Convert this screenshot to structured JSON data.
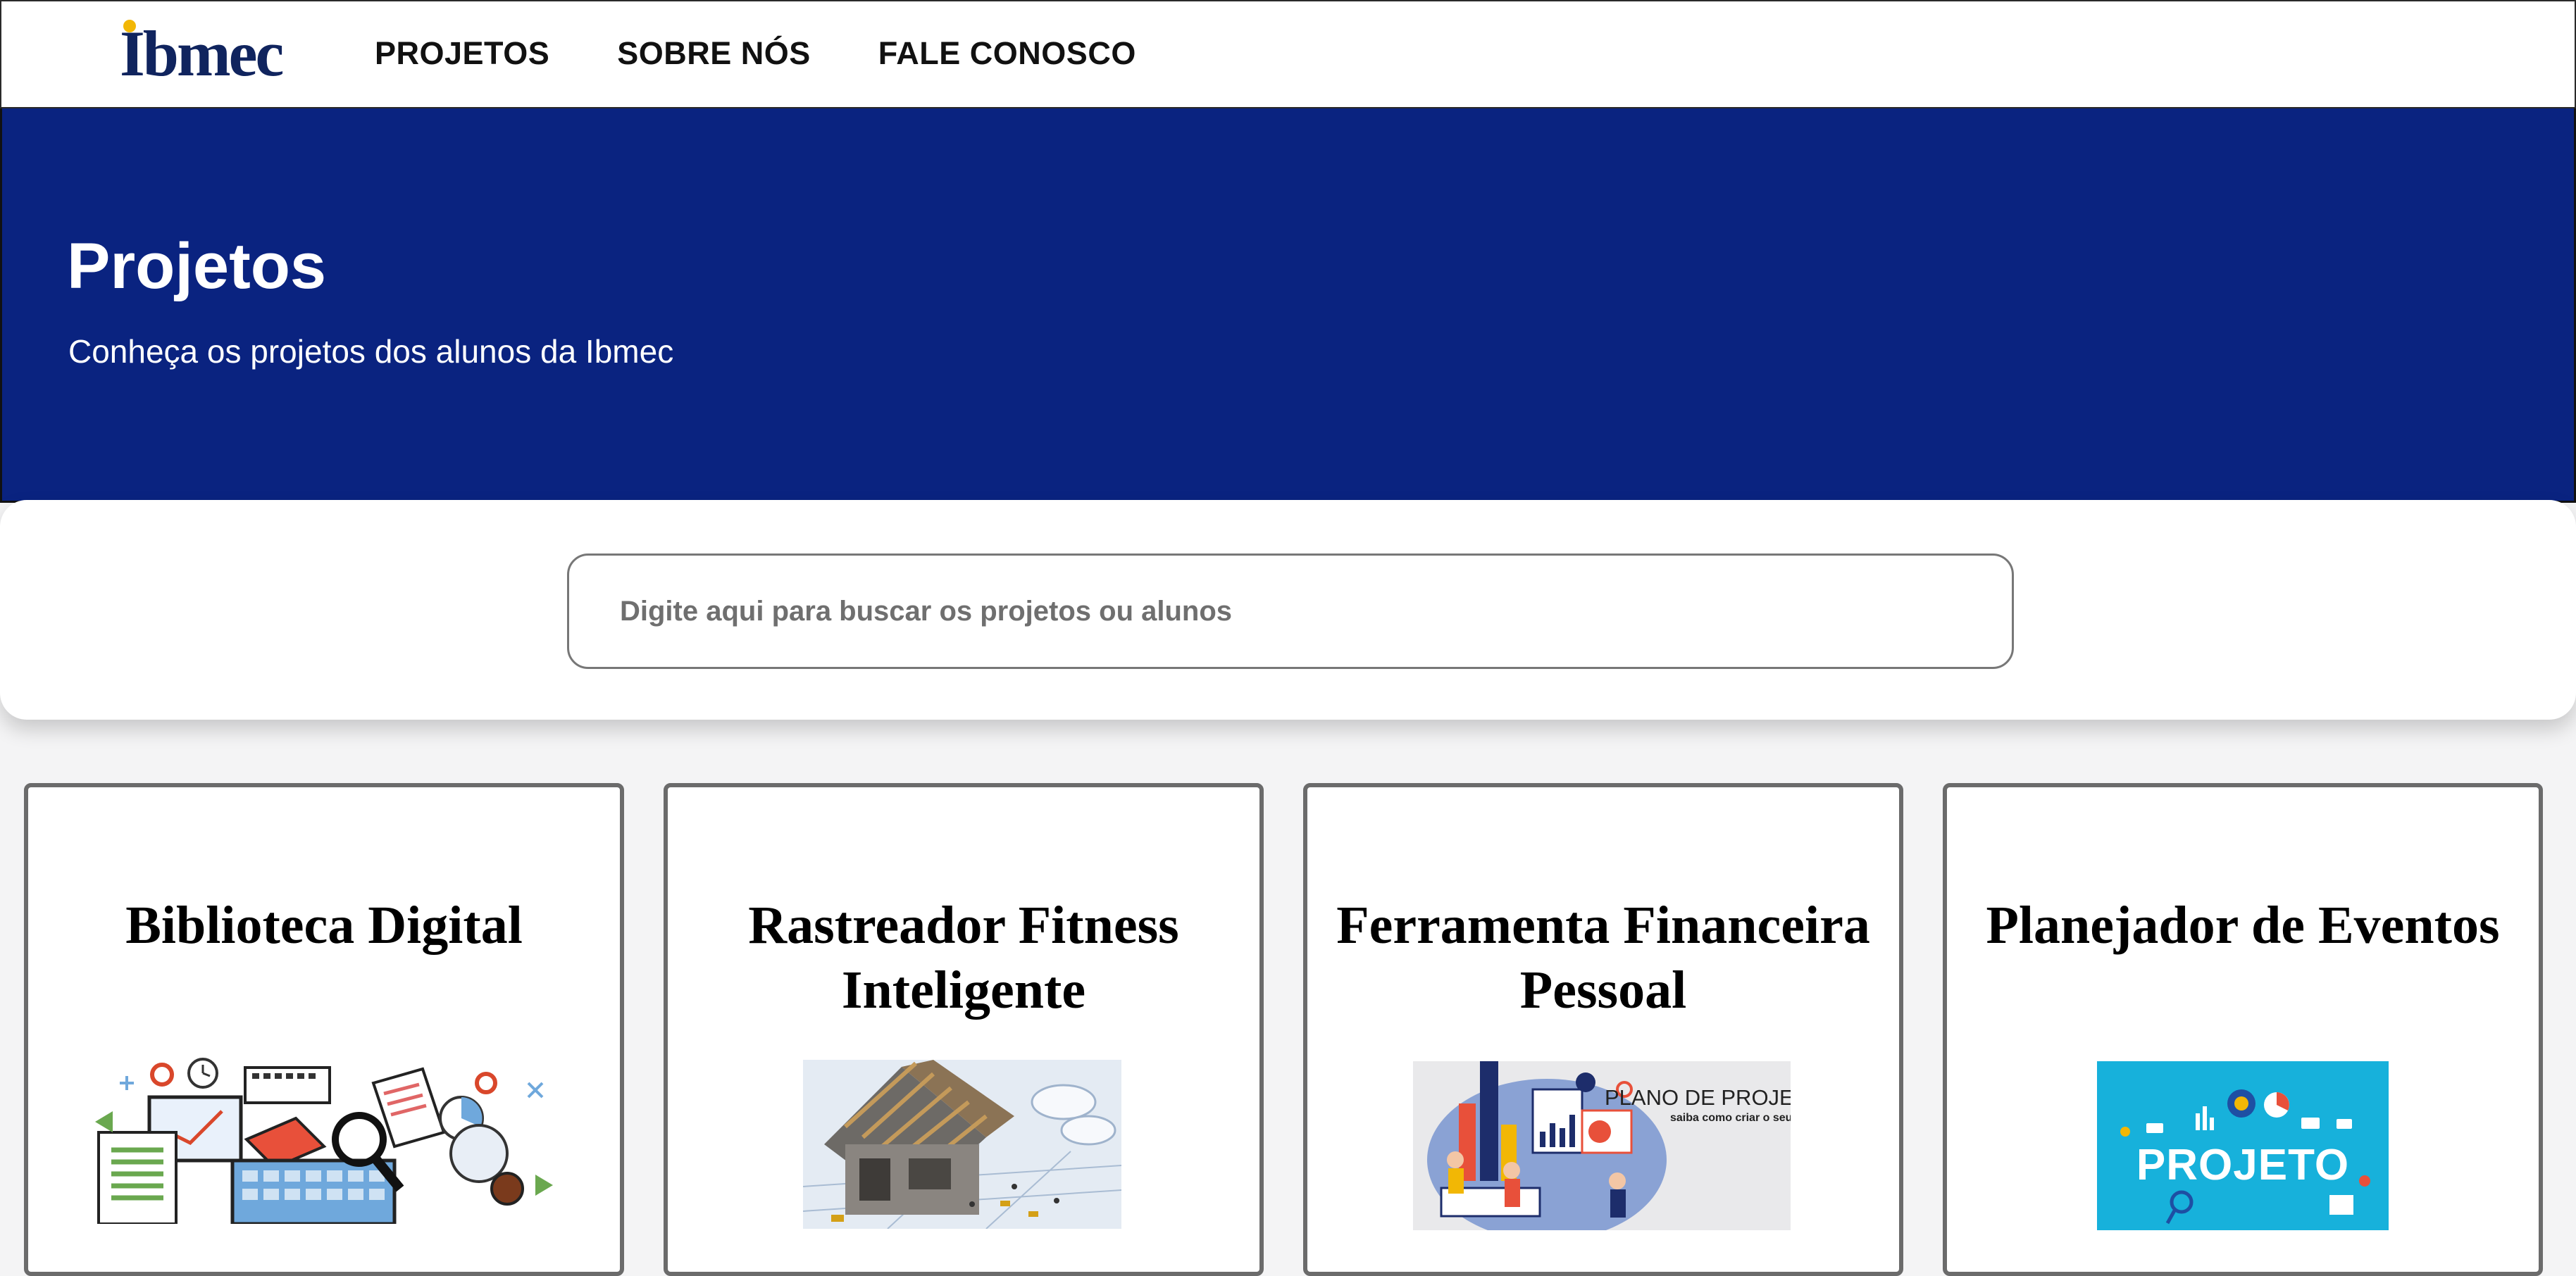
{
  "navbar": {
    "logo_text": "Ibmec",
    "links": [
      "PROJETOS",
      "SOBRE NÓS",
      "FALE CONOSCO"
    ]
  },
  "hero": {
    "title": "Projetos",
    "subtitle": "Conheça os projetos dos alunos da Ibmec"
  },
  "search": {
    "placeholder": "Digite aqui para buscar os projetos ou alunos",
    "value": ""
  },
  "cards": [
    {
      "title_line1": "Biblioteca Digital",
      "title_line2": "",
      "image": "digital-library-illustration"
    },
    {
      "title_line1": "Rastreador Fitness",
      "title_line2": "Inteligente",
      "image": "house-construction-photo"
    },
    {
      "title_line1": "Ferramenta Financeira",
      "title_line2": "Pessoal",
      "image": "project-plan-illustration",
      "image_text": "PLANO DE PROJETO:",
      "image_subtext": "saiba como criar o seu"
    },
    {
      "title_line1": "Planejador de Eventos",
      "title_line2": "",
      "image": "project-banner-illustration",
      "image_text": "PROJETO"
    }
  ],
  "colors": {
    "brand_navy": "#10245e",
    "hero_blue": "#0a2380",
    "logo_accent": "#f2b705",
    "card_border": "#6b6b6b"
  }
}
